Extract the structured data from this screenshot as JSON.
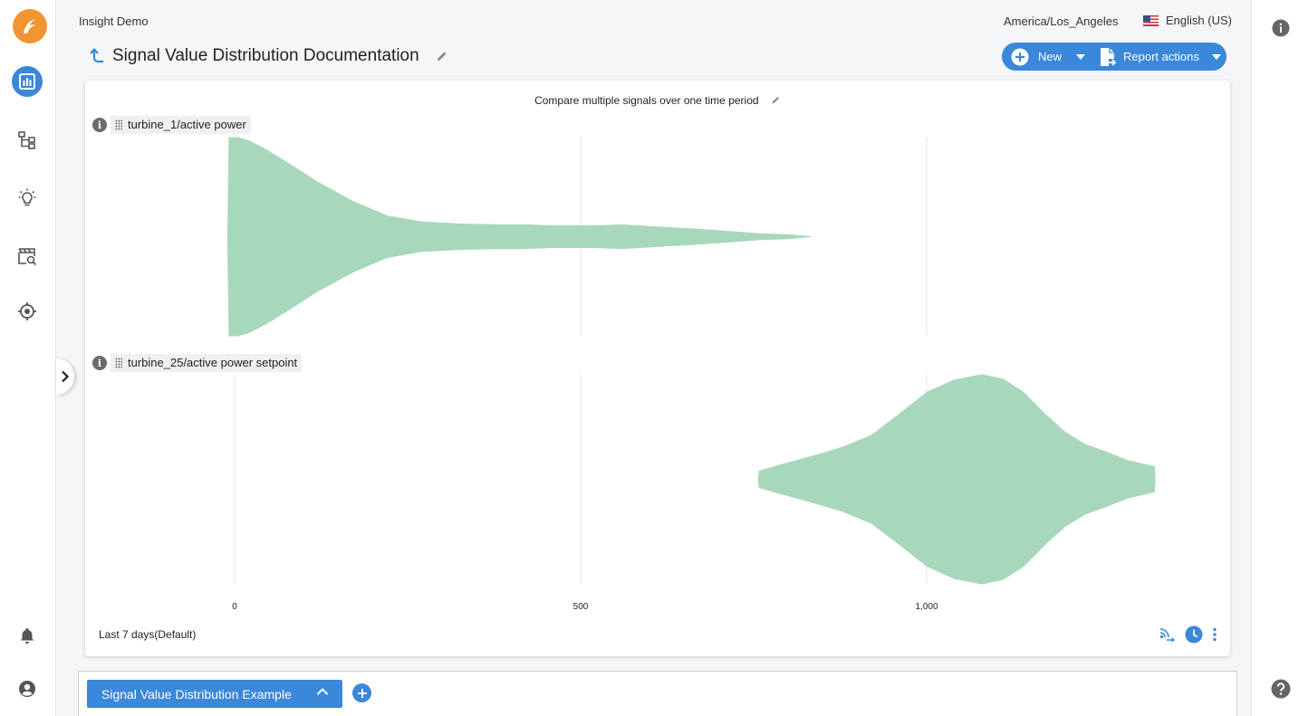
{
  "app": {
    "name": "Insight Demo"
  },
  "header": {
    "timezone": "America/Los_Angeles",
    "language": "English (US)",
    "title": "Signal Value Distribution Documentation",
    "new_label": "New",
    "report_actions_label": "Report actions"
  },
  "leftnav": {
    "items": [
      "chart-icon",
      "tree-icon",
      "lightbulb-icon",
      "scan-search-icon",
      "target-icon",
      "bell-icon",
      "user-icon"
    ]
  },
  "card": {
    "title": "Compare multiple signals over one time period",
    "range_label": "Last 7 days(Default)",
    "signals": [
      {
        "label": "turbine_1/active power"
      },
      {
        "label": "turbine_25/active power setpoint"
      }
    ]
  },
  "colors": {
    "accent": "#3b87d9",
    "violin": "#a8d8bb",
    "logo": "#f39433"
  },
  "chart_data": {
    "type": "violin",
    "x_ticks": [
      "0",
      "500",
      "1,000"
    ],
    "x_tick_values": [
      0,
      500,
      1000
    ],
    "xlim": [
      -10,
      1330
    ],
    "series": [
      {
        "name": "turbine_1/active power",
        "range": [
          -10,
          833
        ],
        "profile": [
          [
            -10,
            0.0
          ],
          [
            -8,
            1.0
          ],
          [
            5,
            1.0
          ],
          [
            20,
            0.97
          ],
          [
            45,
            0.88
          ],
          [
            80,
            0.73
          ],
          [
            120,
            0.55
          ],
          [
            170,
            0.36
          ],
          [
            220,
            0.21
          ],
          [
            270,
            0.15
          ],
          [
            320,
            0.13
          ],
          [
            380,
            0.12
          ],
          [
            420,
            0.12
          ],
          [
            460,
            0.11
          ],
          [
            520,
            0.11
          ],
          [
            560,
            0.12
          ],
          [
            610,
            0.1
          ],
          [
            660,
            0.08
          ],
          [
            700,
            0.06
          ],
          [
            760,
            0.03
          ],
          [
            800,
            0.02
          ],
          [
            833,
            0.0
          ]
        ]
      },
      {
        "name": "turbine_25/active power setpoint",
        "range": [
          757,
          1330
        ],
        "profile": [
          [
            757,
            0.0
          ],
          [
            758,
            0.08
          ],
          [
            790,
            0.14
          ],
          [
            840,
            0.23
          ],
          [
            880,
            0.31
          ],
          [
            920,
            0.42
          ],
          [
            960,
            0.62
          ],
          [
            1000,
            0.83
          ],
          [
            1040,
            0.95
          ],
          [
            1080,
            1.0
          ],
          [
            1110,
            0.96
          ],
          [
            1140,
            0.83
          ],
          [
            1170,
            0.63
          ],
          [
            1200,
            0.45
          ],
          [
            1230,
            0.33
          ],
          [
            1260,
            0.26
          ],
          [
            1290,
            0.18
          ],
          [
            1329,
            0.12
          ],
          [
            1330,
            0.0
          ]
        ]
      }
    ]
  }
}
